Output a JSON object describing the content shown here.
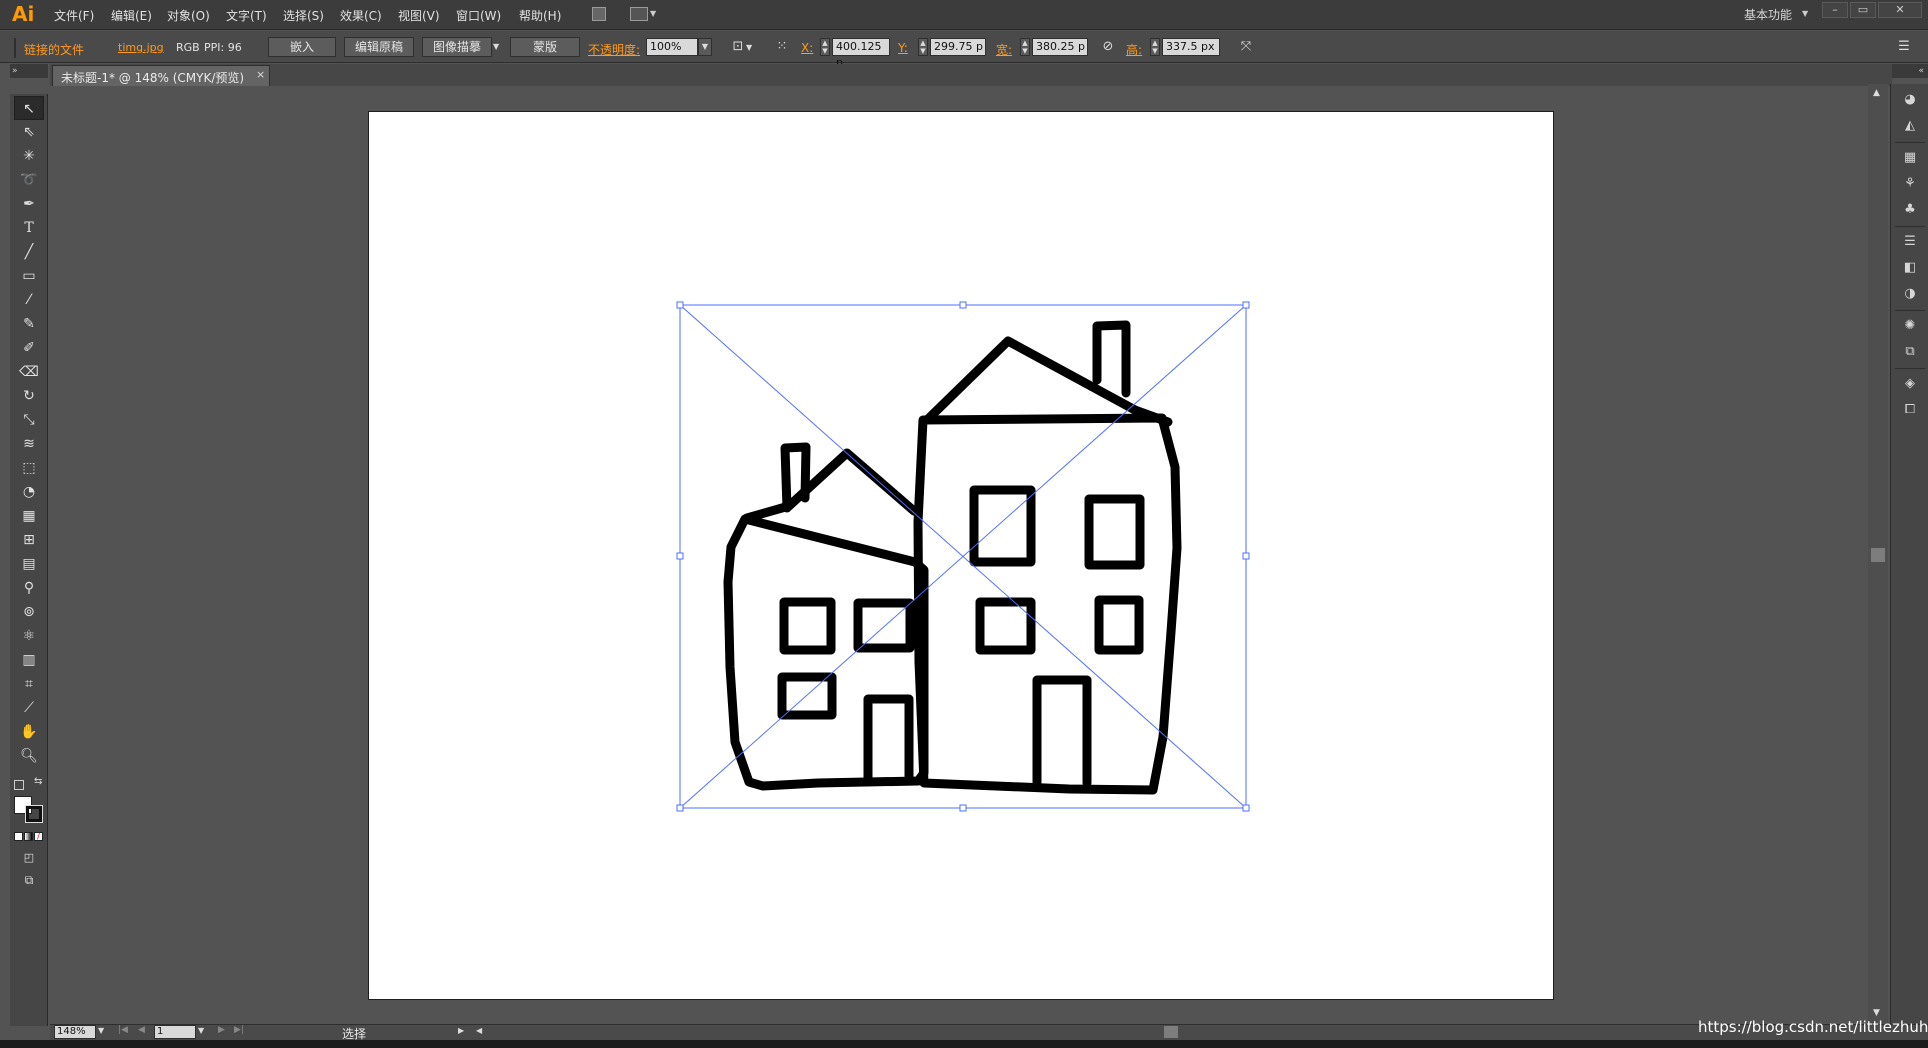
{
  "app": {
    "logo": "Ai"
  },
  "menu": [
    "文件(F)",
    "编辑(E)",
    "对象(O)",
    "文字(T)",
    "选择(S)",
    "效果(C)",
    "视图(V)",
    "窗口(W)",
    "帮助(H)"
  ],
  "workspace": {
    "label": "基本功能"
  },
  "window_buttons": [
    "–",
    "▭",
    "✕"
  ],
  "control": {
    "linked_file": "链接的文件",
    "filename": "timg.jpg",
    "color_mode": "RGB",
    "ppi": "PPI: 96",
    "embed": "嵌入",
    "edit_original": "编辑原稿",
    "image_trace": "图像描摹",
    "mask": "蒙版",
    "opacity_label": "不透明度:",
    "opacity_value": "100%",
    "x_label": "X:",
    "x_value": "400.125 p",
    "y_label": "Y:",
    "y_value": "299.75 p",
    "w_label": "宽:",
    "w_value": "380.25 p",
    "h_label": "高:",
    "h_value": "337.5 px"
  },
  "document_tab": {
    "title": "未标题-1* @ 148% (CMYK/预览)",
    "close": "×"
  },
  "status": {
    "zoom": "148%",
    "artboard_num": "1",
    "tool_status": "选择"
  },
  "watermark": "https://blog.csdn.net/littlezhuhui",
  "colors": {
    "accent": "#ff9a1e",
    "selection": "#4f6fff"
  }
}
